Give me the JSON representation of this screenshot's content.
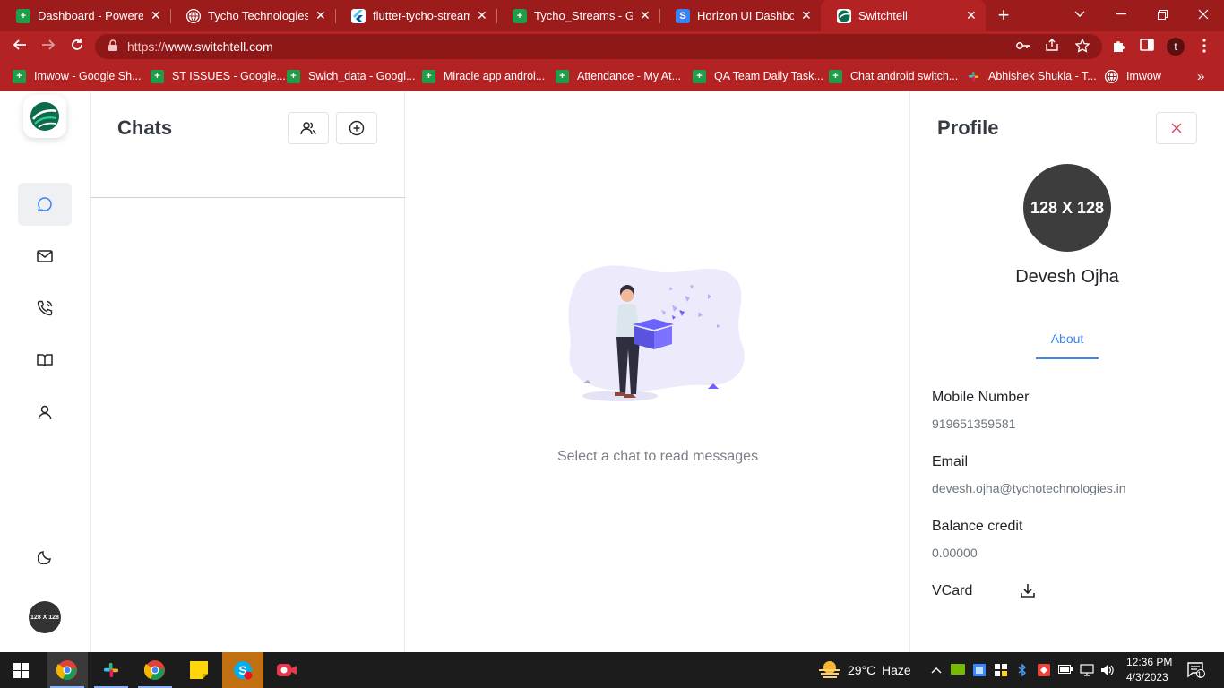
{
  "browser": {
    "tabs": [
      {
        "title": "Dashboard - Powered",
        "icon": "google-sheets-icon",
        "color": "#1e9e4a"
      },
      {
        "title": "Tycho Technologies: M",
        "icon": "globe-icon",
        "color": "#ffffff"
      },
      {
        "title": "flutter-tycho-stream.e",
        "icon": "flutter-icon",
        "color": "#54c5f8"
      },
      {
        "title": "Tycho_Streams - Goog",
        "icon": "google-sheets-icon",
        "color": "#1e9e4a"
      },
      {
        "title": "Horizon UI Dashboard",
        "icon": "horizon-icon",
        "color": "#3b82f6"
      },
      {
        "title": "Switchtell",
        "icon": "switchtell-icon",
        "color": "#0f9d58",
        "active": true
      }
    ],
    "url_prefix": "https://",
    "url_host": "www.switchtell.com",
    "profile_initial": "t",
    "bookmarks": [
      {
        "label": "Imwow - Google Sh...",
        "icon": "google-sheets-icon"
      },
      {
        "label": "ST ISSUES - Google...",
        "icon": "google-sheets-icon"
      },
      {
        "label": "Swich_data - Googl...",
        "icon": "google-sheets-icon"
      },
      {
        "label": "Miracle app androi...",
        "icon": "google-sheets-icon"
      },
      {
        "label": "Attendance - My At...",
        "icon": "google-sheets-icon"
      },
      {
        "label": "QA Team Daily Task...",
        "icon": "google-sheets-icon"
      },
      {
        "label": "Chat android switch...",
        "icon": "google-sheets-icon"
      },
      {
        "label": "Abhishek Shukla - T...",
        "icon": "slack-icon"
      },
      {
        "label": "Imwow",
        "icon": "globe-icon"
      }
    ]
  },
  "rail": {
    "avatar_text": "128 X 128",
    "active_item": "chats"
  },
  "chatlist": {
    "title": "Chats"
  },
  "main": {
    "empty_text": "Select a chat to read messages"
  },
  "profile": {
    "title": "Profile",
    "avatar_text": "128 X 128",
    "name": "Devesh Ojha",
    "tab": "About",
    "mobile_label": "Mobile Number",
    "mobile_value": "919651359581",
    "email_label": "Email",
    "email_value": "devesh.ojha@tychotechnologies.in",
    "balance_label": "Balance credit",
    "balance_value": "0.00000",
    "vcard_label": "VCard"
  },
  "taskbar": {
    "weather_temp": "29°C",
    "weather_desc": "Haze",
    "time": "12:36 PM",
    "date": "4/3/2023",
    "notif_count": "1",
    "skype_badge": "1"
  },
  "colors": {
    "browser_frame": "#9c1c1c",
    "accent_blue": "#3b82f6",
    "close_red": "#e0405a"
  }
}
